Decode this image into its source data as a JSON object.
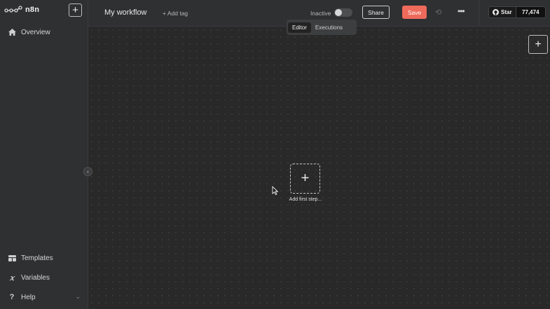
{
  "brand": {
    "name": "n8n"
  },
  "sidebar": {
    "new_button": "+",
    "top_items": [
      {
        "label": "Overview",
        "icon": "home-icon"
      }
    ],
    "bottom_items": [
      {
        "label": "Templates",
        "icon": "templates-icon"
      },
      {
        "label": "Variables",
        "icon": "variables-icon"
      },
      {
        "label": "Help",
        "icon": "help-icon"
      }
    ],
    "collapse_icon": "‹"
  },
  "header": {
    "workflow_name": "My workflow",
    "add_tag": "+ Add tag",
    "status_label": "Inactive",
    "share_label": "Share",
    "save_label": "Save",
    "more_label": "•••",
    "github": {
      "star_label": "Star",
      "count": "77,474"
    }
  },
  "tabs": [
    {
      "label": "Editor",
      "active": true
    },
    {
      "label": "Executions",
      "active": false
    }
  ],
  "canvas": {
    "add_node_label": "+",
    "first_step_symbol": "+",
    "first_step_label": "Add first step..."
  },
  "colors": {
    "accent": "#ee6a5b",
    "background": "#2a2a2a",
    "sidebar": "#2f3032"
  }
}
